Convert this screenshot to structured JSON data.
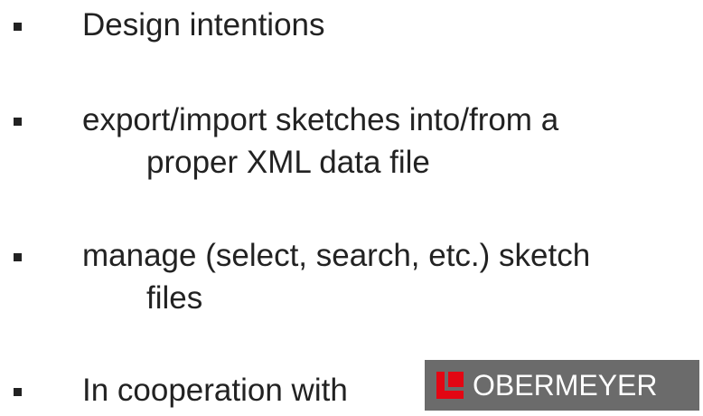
{
  "bullets": [
    {
      "lines": [
        "Design intentions"
      ]
    },
    {
      "lines": [
        "export/import sketches into/from a",
        "proper XML data file"
      ]
    },
    {
      "lines": [
        "manage (select, search, etc.) sketch",
        "files"
      ]
    },
    {
      "lines": [
        "In cooperation with"
      ]
    }
  ],
  "logo": {
    "text": "OBERMEYER",
    "background_color": "#6b6b6b",
    "mark_color": "#e30613"
  },
  "colors": {
    "text": "#222222",
    "background": "#ffffff"
  }
}
